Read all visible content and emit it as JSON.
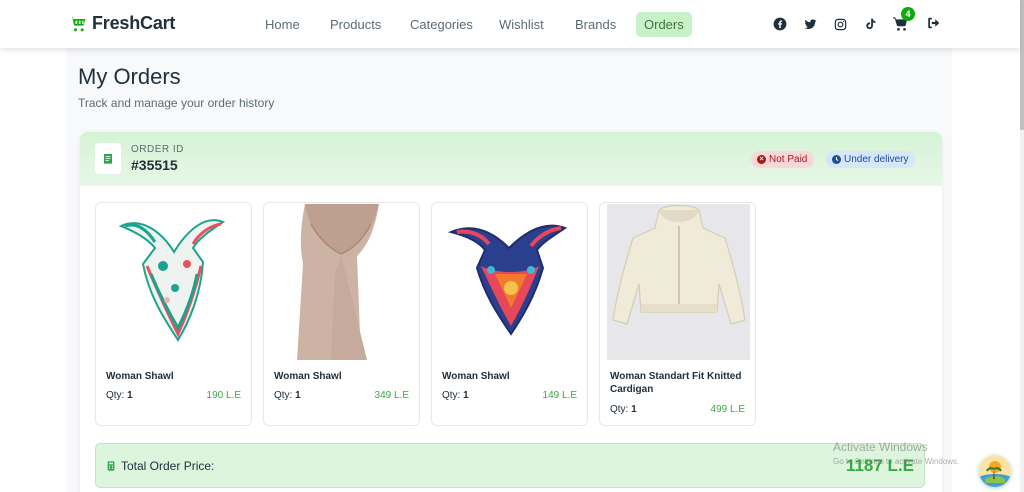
{
  "brand": {
    "name": "FreshCart"
  },
  "nav": {
    "links": [
      "Home",
      "Products",
      "Categories",
      "Wishlist",
      "Brands",
      "Orders"
    ],
    "active": "Orders"
  },
  "socials": [
    "facebook-icon",
    "twitter-icon",
    "instagram-icon",
    "tiktok-icon"
  ],
  "cart": {
    "count": "4"
  },
  "page": {
    "title": "My Orders",
    "subtitle": "Track and manage your order history"
  },
  "order": {
    "id_label": "ORDER ID",
    "id": "#35515",
    "payment_status": "Not Paid",
    "delivery_status": "Under delivery",
    "items": [
      {
        "name": "Woman Shawl",
        "qty_label": "Qty:",
        "qty": "1",
        "price": "190 L.E"
      },
      {
        "name": "Woman Shawl",
        "qty_label": "Qty:",
        "qty": "1",
        "price": "349 L.E"
      },
      {
        "name": "Woman Shawl",
        "qty_label": "Qty:",
        "qty": "1",
        "price": "149 L.E"
      },
      {
        "name": "Woman Standart Fit Knitted Cardigan",
        "qty_label": "Qty:",
        "qty": "1",
        "price": "499 L.E"
      }
    ],
    "total_label": "Total Order Price:",
    "total_value": "1187 L.E"
  },
  "watermark": {
    "title": "Activate Windows",
    "subtitle": "Go to Settings to activate Windows."
  },
  "colors": {
    "brand_green": "#0aad0a",
    "price_green": "#3aa845",
    "active_nav_bg": "#c9f1c9",
    "not_paid_bg": "#fad7d7",
    "delivery_bg": "#d6e6fb"
  }
}
